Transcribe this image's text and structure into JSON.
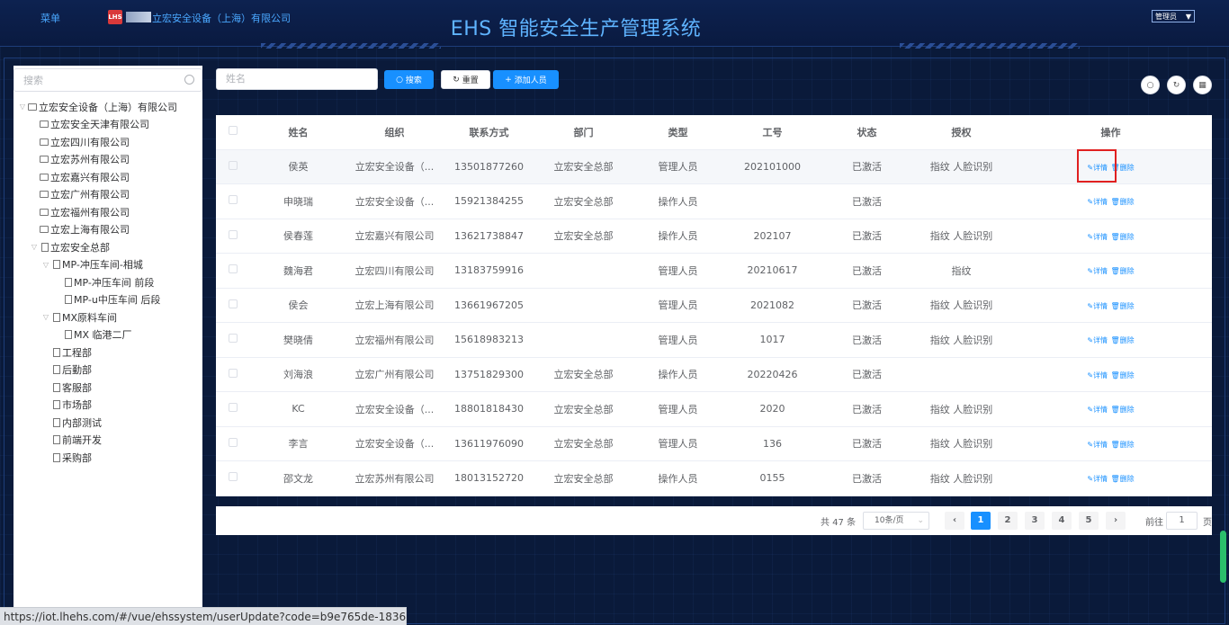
{
  "header": {
    "menu_label": "菜单",
    "logo_badge": "LHS",
    "company": "立宏安全设备（上海）有限公司",
    "system_title": "EHS 智能安全生产管理系统",
    "user_role": "管理员"
  },
  "sidebar": {
    "search_placeholder": "搜索",
    "tree": [
      {
        "label": "立宏安全设备（上海）有限公司",
        "level": 0,
        "arrow": "▽",
        "icon": "pc"
      },
      {
        "label": "立宏安全天津有限公司",
        "level": 1,
        "arrow": "",
        "icon": "pc"
      },
      {
        "label": "立宏四川有限公司",
        "level": 1,
        "arrow": "",
        "icon": "pc"
      },
      {
        "label": "立宏苏州有限公司",
        "level": 1,
        "arrow": "",
        "icon": "pc"
      },
      {
        "label": "立宏嘉兴有限公司",
        "level": 1,
        "arrow": "",
        "icon": "pc"
      },
      {
        "label": "立宏广州有限公司",
        "level": 1,
        "arrow": "",
        "icon": "pc"
      },
      {
        "label": "立宏福州有限公司",
        "level": 1,
        "arrow": "",
        "icon": "pc"
      },
      {
        "label": "立宏上海有限公司",
        "level": 1,
        "arrow": "",
        "icon": "pc"
      },
      {
        "label": "立宏安全总部",
        "level": 1,
        "arrow": "▽",
        "icon": "doc"
      },
      {
        "label": "MP-冲压车间-相城",
        "level": 2,
        "arrow": "▽",
        "icon": "doc"
      },
      {
        "label": "MP-冲压车间 前段",
        "level": 3,
        "arrow": "",
        "icon": "doc"
      },
      {
        "label": "MP-u中压车间 后段",
        "level": 3,
        "arrow": "",
        "icon": "doc"
      },
      {
        "label": "MX原料车间",
        "level": 2,
        "arrow": "▽",
        "icon": "doc"
      },
      {
        "label": "MX 临港二厂",
        "level": 3,
        "arrow": "",
        "icon": "doc"
      },
      {
        "label": "工程部",
        "level": 2,
        "arrow": "",
        "icon": "doc"
      },
      {
        "label": "后勤部",
        "level": 2,
        "arrow": "",
        "icon": "doc"
      },
      {
        "label": "客服部",
        "level": 2,
        "arrow": "",
        "icon": "doc"
      },
      {
        "label": "市场部",
        "level": 2,
        "arrow": "",
        "icon": "doc"
      },
      {
        "label": "内部测试",
        "level": 2,
        "arrow": "",
        "icon": "doc"
      },
      {
        "label": "前端开发",
        "level": 2,
        "arrow": "",
        "icon": "doc"
      },
      {
        "label": "采购部",
        "level": 2,
        "arrow": "",
        "icon": "doc"
      }
    ]
  },
  "toolbar": {
    "name_placeholder": "姓名",
    "search_label": "搜索",
    "reset_label": "重置",
    "add_label": "添加人员"
  },
  "table": {
    "headers": [
      "姓名",
      "组织",
      "联系方式",
      "部门",
      "类型",
      "工号",
      "状态",
      "授权",
      "操作"
    ],
    "detail_label": "详情",
    "delete_label": "删除",
    "rows": [
      [
        "侯英",
        "立宏安全设备（...",
        "13501877260",
        "立宏安全总部",
        "管理人员",
        "202101000",
        "已激活",
        "指纹 人脸识别"
      ],
      [
        "申晓瑞",
        "立宏安全设备（...",
        "15921384255",
        "立宏安全总部",
        "操作人员",
        "",
        "已激活",
        ""
      ],
      [
        "侯春莲",
        "立宏嘉兴有限公司",
        "13621738847",
        "立宏安全总部",
        "操作人员",
        "202107",
        "已激活",
        "指纹 人脸识别"
      ],
      [
        "魏海君",
        "立宏四川有限公司",
        "13183759916",
        "",
        "管理人员",
        "20210617",
        "已激活",
        "指纹"
      ],
      [
        "侯会",
        "立宏上海有限公司",
        "13661967205",
        "",
        "管理人员",
        "2021082",
        "已激活",
        "指纹 人脸识别"
      ],
      [
        "樊晓倩",
        "立宏福州有限公司",
        "15618983213",
        "",
        "管理人员",
        "1017",
        "已激活",
        "指纹 人脸识别"
      ],
      [
        "刘海浪",
        "立宏广州有限公司",
        "13751829300",
        "立宏安全总部",
        "操作人员",
        "20220426",
        "已激活",
        ""
      ],
      [
        "KC",
        "立宏安全设备（...",
        "18801818430",
        "立宏安全总部",
        "管理人员",
        "2020",
        "已激活",
        "指纹 人脸识别"
      ],
      [
        "李言",
        "立宏安全设备（...",
        "13611976090",
        "立宏安全总部",
        "管理人员",
        "136",
        "已激活",
        "指纹 人脸识别"
      ],
      [
        "邵文龙",
        "立宏苏州有限公司",
        "18013152720",
        "立宏安全总部",
        "操作人员",
        "0155",
        "已激活",
        "指纹 人脸识别"
      ]
    ]
  },
  "pagination": {
    "total_text": "共 47 条",
    "page_size": "10条/页",
    "pages": [
      "1",
      "2",
      "3",
      "4",
      "5"
    ],
    "current_page": "1",
    "goto_label": "前往",
    "goto_value": "1",
    "page_unit": "页"
  },
  "status_url": "https://iot.lhehs.com/#/vue/ehssystem/userUpdate?code=b9e765de-1836-...",
  "colors": {
    "accent": "#1890ff",
    "header_text": "#4aa8ff",
    "highlight_box": "#e02020"
  }
}
